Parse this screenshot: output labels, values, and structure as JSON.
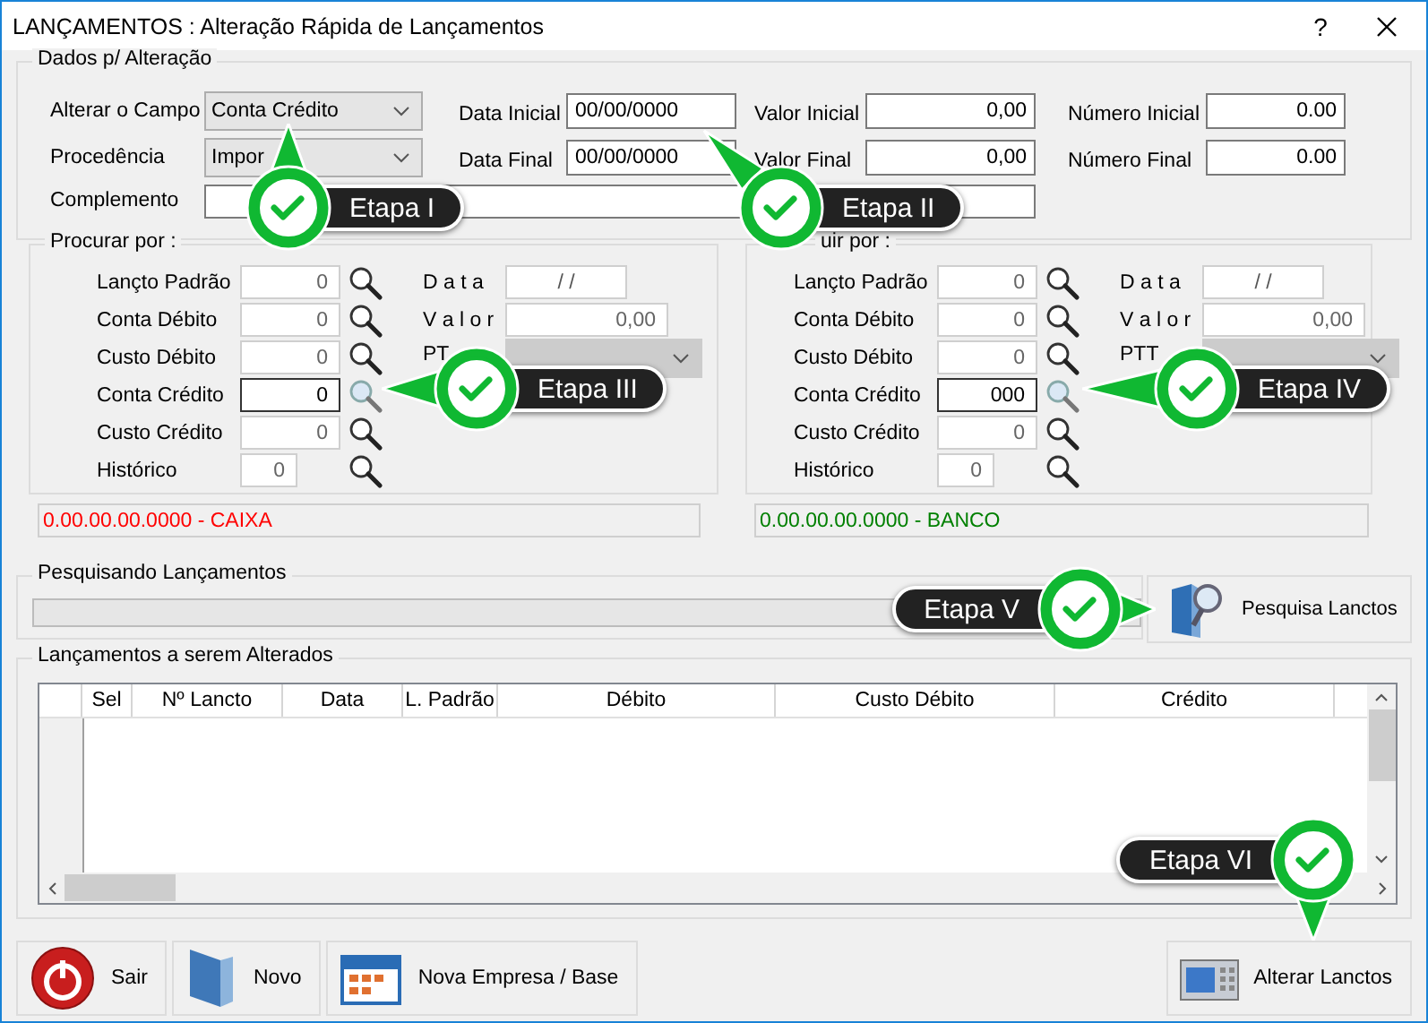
{
  "window": {
    "title": "LANÇAMENTOS : Alteração Rápida de Lançamentos",
    "help": "?"
  },
  "dados": {
    "legend": "Dados p/ Alteração",
    "selects": [
      {
        "label": "Alterar o Campo",
        "value": "Conta Crédito"
      },
      {
        "label": "Procedência",
        "value": "Impor"
      }
    ],
    "columns": [
      [
        {
          "label": "Data Inicial",
          "value": "00/00/0000"
        },
        {
          "label": "Data Final",
          "value": "00/00/0000"
        }
      ],
      [
        {
          "label": "Valor Inicial",
          "value": "0,00"
        },
        {
          "label": "Valor Final",
          "value": "0,00"
        }
      ],
      [
        {
          "label": "Número Inicial",
          "value": "0.00"
        },
        {
          "label": "Número Final",
          "value": "0.00"
        }
      ]
    ],
    "complemento": {
      "label": "Complemento"
    }
  },
  "groups": [
    {
      "legend": "Procurar por :",
      "fields": [
        {
          "label": "Lançto Padrão",
          "value": "0",
          "kind": "long",
          "focused": false
        },
        {
          "label": "Conta Débito",
          "value": "0",
          "kind": "long",
          "focused": false
        },
        {
          "label": "Custo Débito",
          "value": "0",
          "kind": "long",
          "focused": false
        },
        {
          "label": "Conta Crédito",
          "value": "0",
          "kind": "long",
          "focused": true
        },
        {
          "label": "Custo Crédito",
          "value": "0",
          "kind": "long",
          "focused": false
        },
        {
          "label": "Histórico",
          "value": "0",
          "kind": "short",
          "focused": false
        }
      ],
      "data": {
        "label": "D a t a",
        "value": "/ /"
      },
      "valor": {
        "label": "V a l o r",
        "value": "0,00"
      },
      "ptt": {
        "label": "PT"
      },
      "account": {
        "text": "0.00.00.00.0000 - CAIXA",
        "color": "#ff0000"
      }
    },
    {
      "legend": "uir por :",
      "fields": [
        {
          "label": "Lançto Padrão",
          "value": "0",
          "kind": "long",
          "focused": false
        },
        {
          "label": "Conta Débito",
          "value": "0",
          "kind": "long",
          "focused": false
        },
        {
          "label": "Custo Débito",
          "value": "0",
          "kind": "long",
          "focused": false
        },
        {
          "label": "Conta Crédito",
          "value": "000",
          "kind": "long",
          "focused": true
        },
        {
          "label": "Custo Crédito",
          "value": "0",
          "kind": "long",
          "focused": false
        },
        {
          "label": "Histórico",
          "value": "0",
          "kind": "short",
          "focused": false
        }
      ],
      "data": {
        "label": "D a t a",
        "value": "/ /"
      },
      "valor": {
        "label": "V a l o r",
        "value": "0,00"
      },
      "ptt": {
        "label": "PTT"
      },
      "account": {
        "text": "0.00.00.00.0000 - BANCO",
        "color": "#008000"
      }
    }
  ],
  "search": {
    "legend": "Pesquisando Lançamentos",
    "level": 0,
    "button": "Pesquisa Lanctos"
  },
  "table": {
    "legend": "Lançamentos a serem Alterados",
    "columns": [
      "Sel",
      "Nº Lancto",
      "Data",
      "L. Padrão",
      "Débito",
      "Custo Débito",
      "Crédito"
    ]
  },
  "buttons": [
    {
      "label": "Sair"
    },
    {
      "label": "Novo"
    },
    {
      "label": "Nova Empresa / Base"
    },
    {
      "label": "Alterar Lanctos"
    }
  ],
  "callouts": [
    {
      "label": "Etapa I"
    },
    {
      "label": "Etapa II"
    },
    {
      "label": "Etapa III"
    },
    {
      "label": "Etapa IV"
    },
    {
      "label": "Etapa V"
    },
    {
      "label": "Etapa VI"
    }
  ]
}
